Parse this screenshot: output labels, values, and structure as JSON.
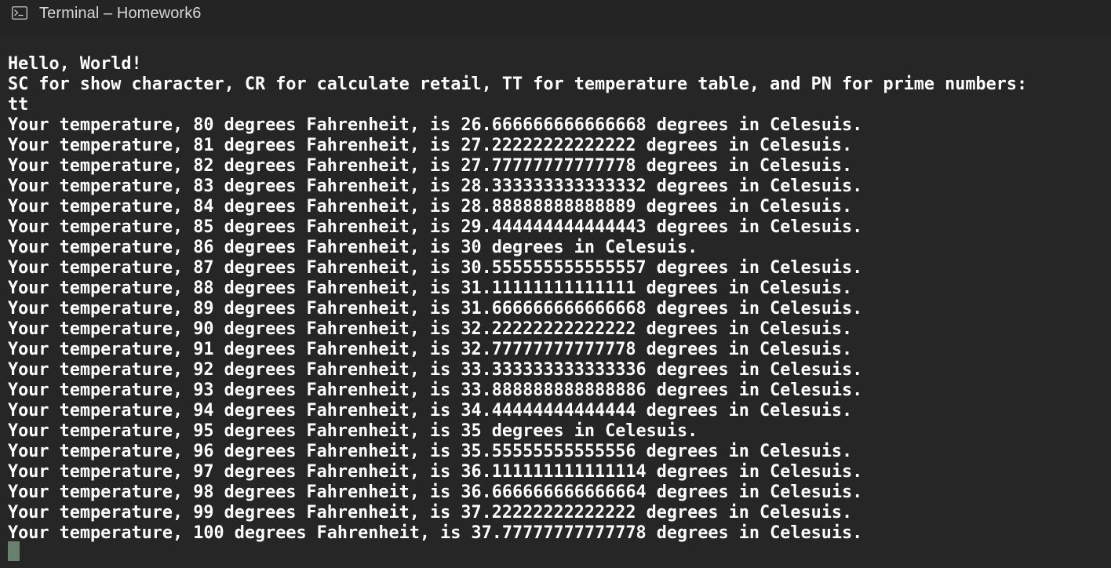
{
  "window": {
    "title": "Terminal – Homework6",
    "icon": "terminal-icon"
  },
  "terminal": {
    "lines": [
      "Hello, World!",
      "SC for show character, CR for calculate retail, TT for temperature table, and PN for prime numbers:",
      "tt",
      "Your temperature, 80 degrees Fahrenheit, is 26.666666666666668 degrees in Celesuis.",
      "Your temperature, 81 degrees Fahrenheit, is 27.22222222222222 degrees in Celesuis.",
      "Your temperature, 82 degrees Fahrenheit, is 27.77777777777778 degrees in Celesuis.",
      "Your temperature, 83 degrees Fahrenheit, is 28.333333333333332 degrees in Celesuis.",
      "Your temperature, 84 degrees Fahrenheit, is 28.88888888888889 degrees in Celesuis.",
      "Your temperature, 85 degrees Fahrenheit, is 29.444444444444443 degrees in Celesuis.",
      "Your temperature, 86 degrees Fahrenheit, is 30 degrees in Celesuis.",
      "Your temperature, 87 degrees Fahrenheit, is 30.555555555555557 degrees in Celesuis.",
      "Your temperature, 88 degrees Fahrenheit, is 31.11111111111111 degrees in Celesuis.",
      "Your temperature, 89 degrees Fahrenheit, is 31.666666666666668 degrees in Celesuis.",
      "Your temperature, 90 degrees Fahrenheit, is 32.22222222222222 degrees in Celesuis.",
      "Your temperature, 91 degrees Fahrenheit, is 32.77777777777778 degrees in Celesuis.",
      "Your temperature, 92 degrees Fahrenheit, is 33.333333333333336 degrees in Celesuis.",
      "Your temperature, 93 degrees Fahrenheit, is 33.888888888888886 degrees in Celesuis.",
      "Your temperature, 94 degrees Fahrenheit, is 34.44444444444444 degrees in Celesuis.",
      "Your temperature, 95 degrees Fahrenheit, is 35 degrees in Celesuis.",
      "Your temperature, 96 degrees Fahrenheit, is 35.55555555555556 degrees in Celesuis.",
      "Your temperature, 97 degrees Fahrenheit, is 36.111111111111114 degrees in Celesuis.",
      "Your temperature, 98 degrees Fahrenheit, is 36.666666666666664 degrees in Celesuis.",
      "Your temperature, 99 degrees Fahrenheit, is 37.22222222222222 degrees in Celesuis.",
      "Your temperature, 100 degrees Fahrenheit, is 37.77777777777778 degrees in Celesuis."
    ]
  },
  "colors": {
    "background": "#262626",
    "titlebar": "#242424",
    "text": "#ffffff",
    "title_text": "#d6d6d6",
    "cursor": "#6a806f"
  }
}
